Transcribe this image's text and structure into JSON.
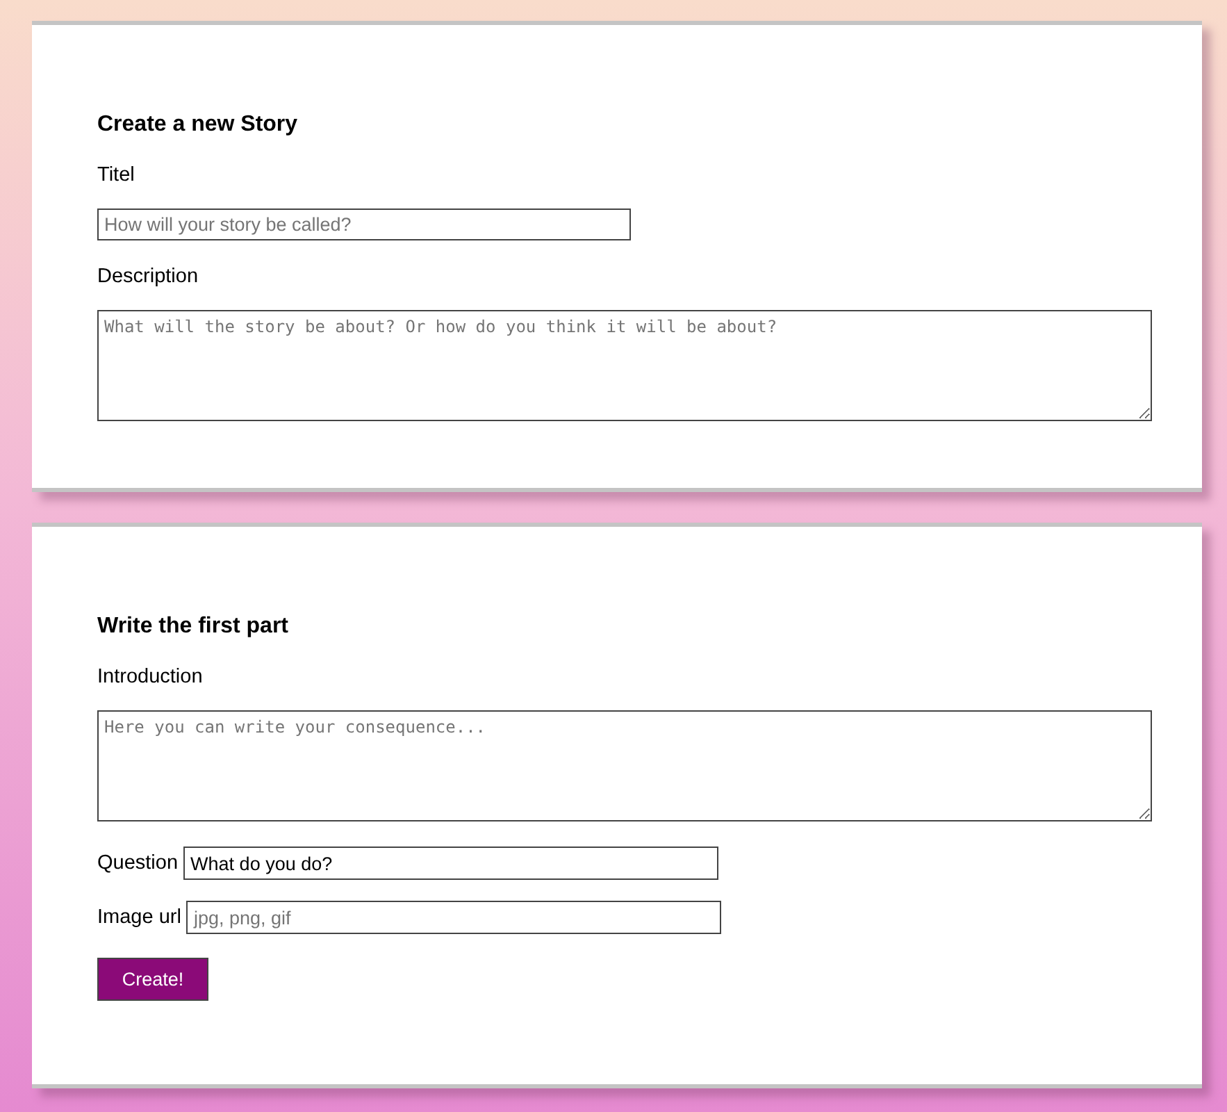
{
  "sections": [
    {
      "heading": "Create a new Story",
      "fields": [
        {
          "kind": "text",
          "label": "Titel",
          "placeholder": "How will your story be called?"
        },
        {
          "kind": "textarea",
          "label": "Description",
          "placeholder": "What will the story be about? Or how do you think it will be about?"
        }
      ]
    },
    {
      "heading": "Write the first part",
      "fields": [
        {
          "kind": "textarea",
          "label": "Introduction",
          "placeholder": "Here you can write your consequence..."
        },
        {
          "kind": "inline",
          "label": "Question",
          "value": "What do you do?"
        },
        {
          "kind": "inline",
          "label": "Image url",
          "placeholder": "jpg, png, gif"
        }
      ],
      "button": "Create!"
    }
  ]
}
